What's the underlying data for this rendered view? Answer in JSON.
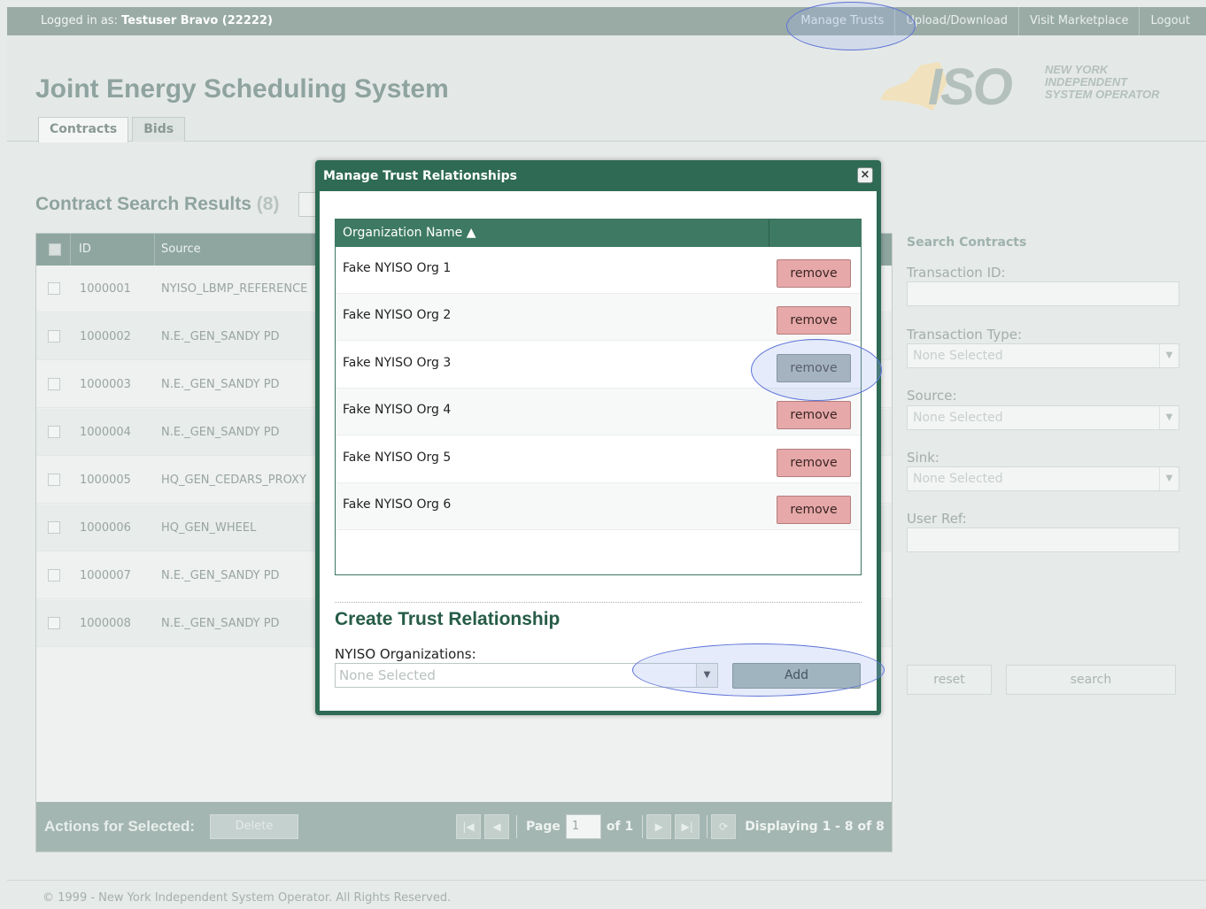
{
  "topbar": {
    "login_prefix": "Logged in as:",
    "user": "Testuser Bravo (22222)",
    "nav": [
      "Manage Trusts",
      "Upload/Download",
      "Visit Marketplace",
      "Logout"
    ]
  },
  "header": {
    "title": "Joint Energy Scheduling System",
    "tabs": [
      "Contracts",
      "Bids"
    ],
    "logo": {
      "mark": "ISO",
      "line1": "NEW YORK",
      "line2": "INDEPENDENT",
      "line3": "SYSTEM OPERATOR"
    }
  },
  "results": {
    "title": "Contract Search Results",
    "count": "(8)",
    "columns": [
      "ID",
      "Source"
    ],
    "rows": [
      {
        "id": "1000001",
        "source": "NYISO_LBMP_REFERENCE"
      },
      {
        "id": "1000002",
        "source": "N.E._GEN_SANDY PD"
      },
      {
        "id": "1000003",
        "source": "N.E._GEN_SANDY PD"
      },
      {
        "id": "1000004",
        "source": "N.E._GEN_SANDY PD"
      },
      {
        "id": "1000005",
        "source": "HQ_GEN_CEDARS_PROXY"
      },
      {
        "id": "1000006",
        "source": "HQ_GEN_WHEEL"
      },
      {
        "id": "1000007",
        "source": "N.E._GEN_SANDY PD"
      },
      {
        "id": "1000008",
        "source": "N.E._GEN_SANDY PD"
      }
    ],
    "footer": {
      "actions_label": "Actions for Selected:",
      "delete": "Delete",
      "page_label": "Page",
      "page_value": "1",
      "of_label": "of 1",
      "displaying": "Displaying 1 - 8 of 8"
    }
  },
  "search": {
    "title": "Search Contracts",
    "transaction_id_label": "Transaction ID:",
    "transaction_type_label": "Transaction Type:",
    "source_label": "Source:",
    "sink_label": "Sink:",
    "user_ref_label": "User Ref:",
    "none_selected": "None Selected",
    "reset": "reset",
    "search": "search"
  },
  "modal": {
    "title": "Manage Trust Relationships",
    "close_glyph": "×",
    "column_header": "Organization Name ▲",
    "remove_label": "remove",
    "orgs": [
      "Fake NYISO Org 1",
      "Fake NYISO Org 2",
      "Fake NYISO Org 3",
      "Fake NYISO Org 4",
      "Fake NYISO Org 5",
      "Fake NYISO Org 6"
    ],
    "create_title": "Create Trust Relationship",
    "org_select_label": "NYISO Organizations:",
    "org_select_value": "None Selected",
    "add_label": "Add"
  },
  "footer": {
    "copyright": "© 1999 - New York Independent System Operator. All Rights Reserved."
  },
  "colors": {
    "modal_accent": "#2e6a54",
    "remove_button": "#e6a8a8",
    "highlight": "#5d72d8"
  }
}
